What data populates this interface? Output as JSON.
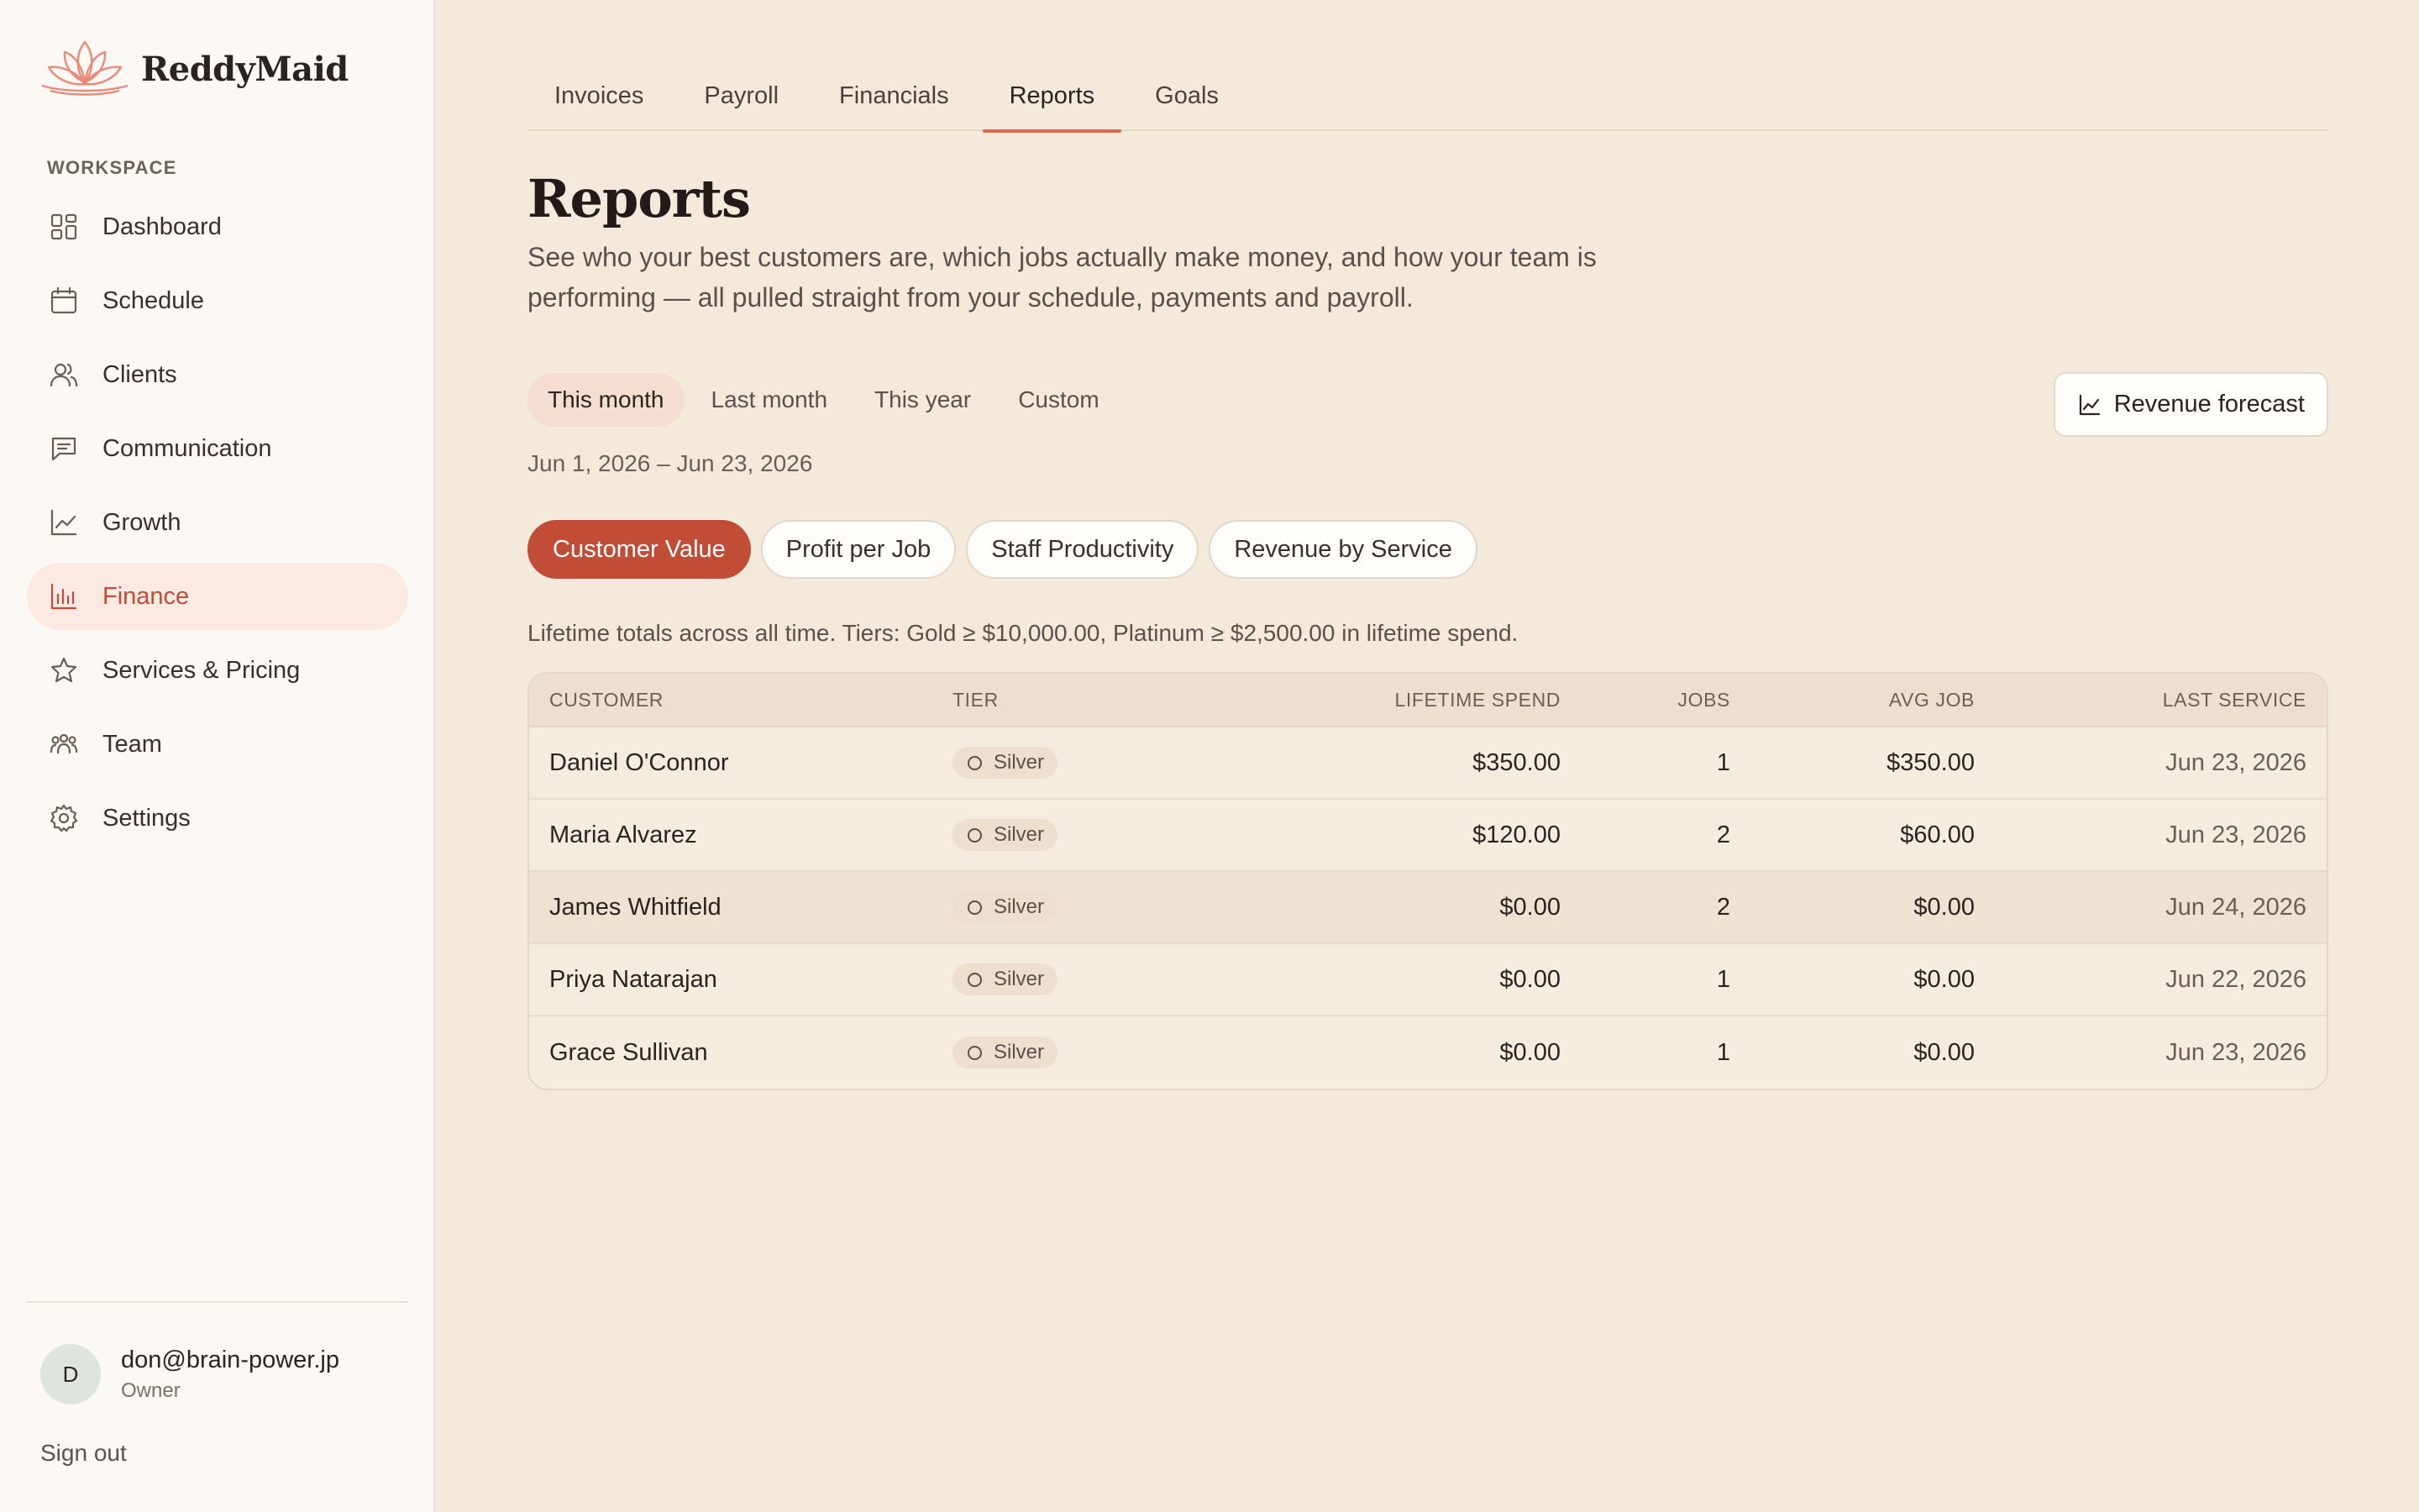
{
  "brand": {
    "name": "ReddyMaid",
    "accent": "#c14d36",
    "logo_color": "#e9897a"
  },
  "sidebar": {
    "section_label": "WORKSPACE",
    "items": [
      {
        "label": "Dashboard",
        "icon": "grid-icon"
      },
      {
        "label": "Schedule",
        "icon": "calendar-icon"
      },
      {
        "label": "Clients",
        "icon": "users-icon"
      },
      {
        "label": "Communication",
        "icon": "message-icon"
      },
      {
        "label": "Growth",
        "icon": "trend-icon"
      },
      {
        "label": "Finance",
        "icon": "bar-chart-icon",
        "active": true
      },
      {
        "label": "Services & Pricing",
        "icon": "star-icon"
      },
      {
        "label": "Team",
        "icon": "team-icon"
      },
      {
        "label": "Settings",
        "icon": "gear-icon"
      }
    ],
    "user": {
      "initial": "D",
      "email": "don@brain-power.jp",
      "role": "Owner"
    },
    "signout": "Sign out"
  },
  "tabs": [
    "Invoices",
    "Payroll",
    "Financials",
    "Reports",
    "Goals"
  ],
  "active_tab": "Reports",
  "page": {
    "title": "Reports",
    "subtitle": "See who your best customers are, which jobs actually make money, and how your team is performing — all pulled straight from your schedule, payments and payroll."
  },
  "periods": [
    "This month",
    "Last month",
    "This year",
    "Custom"
  ],
  "active_period": "This month",
  "forecast_button": "Revenue forecast",
  "date_range": "Jun 1, 2026 – Jun 23, 2026",
  "report_tabs": [
    "Customer Value",
    "Profit per Job",
    "Staff Productivity",
    "Revenue by Service"
  ],
  "active_report": "Customer Value",
  "note": "Lifetime totals across all time. Tiers: Gold ≥ $10,000.00, Platinum ≥ $2,500.00 in lifetime spend.",
  "table": {
    "headers": {
      "customer": "CUSTOMER",
      "tier": "TIER",
      "spend": "LIFETIME SPEND",
      "jobs": "JOBS",
      "avg": "AVG JOB",
      "last": "LAST SERVICE"
    },
    "rows": [
      {
        "customer": "Daniel O'Connor",
        "tier": "Silver",
        "spend": "$350.00",
        "jobs": "1",
        "avg": "$350.00",
        "last": "Jun 23, 2026"
      },
      {
        "customer": "Maria Alvarez",
        "tier": "Silver",
        "spend": "$120.00",
        "jobs": "2",
        "avg": "$60.00",
        "last": "Jun 23, 2026"
      },
      {
        "customer": "James Whitfield",
        "tier": "Silver",
        "spend": "$0.00",
        "jobs": "2",
        "avg": "$0.00",
        "last": "Jun 24, 2026"
      },
      {
        "customer": "Priya Natarajan",
        "tier": "Silver",
        "spend": "$0.00",
        "jobs": "1",
        "avg": "$0.00",
        "last": "Jun 22, 2026"
      },
      {
        "customer": "Grace Sullivan",
        "tier": "Silver",
        "spend": "$0.00",
        "jobs": "1",
        "avg": "$0.00",
        "last": "Jun 23, 2026"
      }
    ]
  }
}
